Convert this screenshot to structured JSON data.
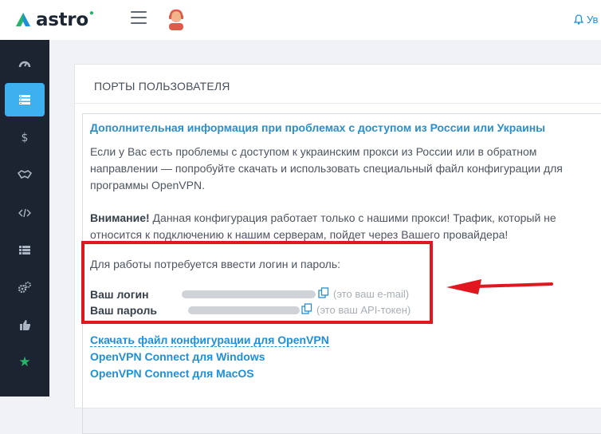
{
  "header": {
    "logo_text": "astro",
    "notification_label": "Ув"
  },
  "sidebar": {
    "items": [
      {
        "icon": "dashboard-icon",
        "active": false
      },
      {
        "icon": "server-icon",
        "active": true
      },
      {
        "icon": "dollar-icon",
        "active": false
      },
      {
        "icon": "handshake-icon",
        "active": false
      },
      {
        "icon": "code-icon",
        "active": false
      },
      {
        "icon": "list-icon",
        "active": false
      },
      {
        "icon": "settings-icon",
        "active": false
      },
      {
        "icon": "thumbs-up-icon",
        "active": false
      },
      {
        "icon": "star-icon",
        "active": false
      }
    ]
  },
  "panel": {
    "title": "ПОРТЫ ПОЛЬЗОВАТЕЛЯ"
  },
  "info": {
    "title": "Дополнительная информация при проблемах с доступом из России или Украины",
    "para1_line1": "Если у Вас есть проблемы с доступом к украинским прокси из России или в обратном",
    "para1_line2": "направлении — попробуйте скачать и использовать специальный файл конфигурации для",
    "para1_line3": "программы OpenVPN.",
    "warning_label": "Внимание!",
    "warning_line1": " Данная конфигурация работает только с нашими прокси! Трафик, который не",
    "warning_line2": "относится к подключению к нашим серверам, пойдет через Вашего провайдера!",
    "credentials_intro": "Для работы потребуется ввести логин и пароль:",
    "login_label": "Ваш логин",
    "login_hint": "(это ваш e-mail)",
    "password_label": "Ваш пароль",
    "password_hint": "(это ваш API-токен)"
  },
  "links": {
    "download_config": "Скачать файл конфигурации для OpenVPN",
    "windows": "OpenVPN Connect для Windows",
    "macos": "OpenVPN Connect для MacOS"
  },
  "colors": {
    "accent": "#1e8fd8",
    "sidebar_bg": "#1b2430",
    "sidebar_active": "#3db0f0",
    "highlight": "#e0171f"
  }
}
